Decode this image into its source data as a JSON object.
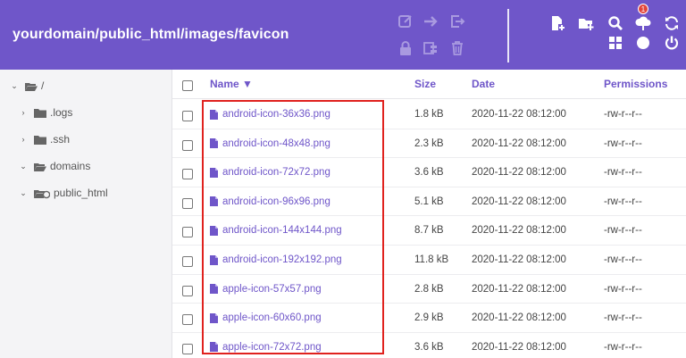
{
  "header": {
    "path": "yourdomain/public_html/images/favicon",
    "notification_count": "1",
    "accent": "#6f56c9"
  },
  "toolbar": {
    "left_icons": [
      "edit-icon",
      "arrow-right-icon",
      "exit-icon",
      "lock-icon",
      "archive-icon",
      "trash-icon"
    ],
    "right_icons": [
      "new-file-icon",
      "new-folder-icon",
      "search-icon",
      "upload-icon",
      "refresh-icon",
      "grid-icon",
      "globe-icon",
      "power-icon"
    ]
  },
  "sidebar": {
    "items": [
      {
        "label": "/"
      },
      {
        "label": ".logs"
      },
      {
        "label": ".ssh"
      },
      {
        "label": "domains"
      },
      {
        "label": "public_html"
      }
    ]
  },
  "table": {
    "columns": {
      "name": "Name ▼",
      "size": "Size",
      "date": "Date",
      "permissions": "Permissions"
    },
    "rows": [
      {
        "name": "android-icon-36x36.png",
        "size": "1.8 kB",
        "date": "2020-11-22 08:12:00",
        "perm": "-rw-r--r--"
      },
      {
        "name": "android-icon-48x48.png",
        "size": "2.3 kB",
        "date": "2020-11-22 08:12:00",
        "perm": "-rw-r--r--"
      },
      {
        "name": "android-icon-72x72.png",
        "size": "3.6 kB",
        "date": "2020-11-22 08:12:00",
        "perm": "-rw-r--r--"
      },
      {
        "name": "android-icon-96x96.png",
        "size": "5.1 kB",
        "date": "2020-11-22 08:12:00",
        "perm": "-rw-r--r--"
      },
      {
        "name": "android-icon-144x144.png",
        "size": "8.7 kB",
        "date": "2020-11-22 08:12:00",
        "perm": "-rw-r--r--"
      },
      {
        "name": "android-icon-192x192.png",
        "size": "11.8 kB",
        "date": "2020-11-22 08:12:00",
        "perm": "-rw-r--r--"
      },
      {
        "name": "apple-icon-57x57.png",
        "size": "2.8 kB",
        "date": "2020-11-22 08:12:00",
        "perm": "-rw-r--r--"
      },
      {
        "name": "apple-icon-60x60.png",
        "size": "2.9 kB",
        "date": "2020-11-22 08:12:00",
        "perm": "-rw-r--r--"
      },
      {
        "name": "apple-icon-72x72.png",
        "size": "3.6 kB",
        "date": "2020-11-22 08:12:00",
        "perm": "-rw-r--r--"
      }
    ]
  }
}
